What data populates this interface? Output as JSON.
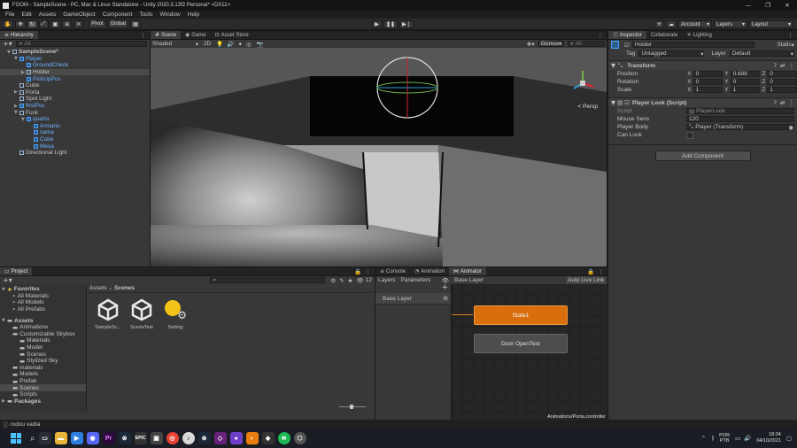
{
  "window": {
    "title": "FOOM - SampleScene - PC, Mac & Linux Standalone - Unity 2020.3.13f2 Personal* <DX11>",
    "controls": [
      "—",
      "❐",
      "✕"
    ]
  },
  "menu": [
    "File",
    "Edit",
    "Assets",
    "GameObject",
    "Component",
    "Tools",
    "Window",
    "Help"
  ],
  "toolbar": {
    "pivot": "Pivot",
    "global": "Global",
    "account": "Account",
    "layers": "Layers",
    "layout": "Layout"
  },
  "hierarchy": {
    "tab": "Hierarchy",
    "search_placeholder": "All",
    "items": [
      {
        "label": "SampleScene*",
        "level": 0,
        "arrow": "▼"
      },
      {
        "label": "Player",
        "level": 1,
        "arrow": "▼",
        "blue": true
      },
      {
        "label": "GroundCheck",
        "level": 2,
        "arrow": "",
        "blue": true
      },
      {
        "label": "Holder",
        "level": 2,
        "arrow": "▶",
        "selected": true
      },
      {
        "label": "PickUpPos",
        "level": 2,
        "arrow": "",
        "blue": true
      },
      {
        "label": "Cube",
        "level": 1,
        "arrow": ""
      },
      {
        "label": "Porta",
        "level": 1,
        "arrow": "▶"
      },
      {
        "label": "Spot Light",
        "level": 1,
        "arrow": ""
      },
      {
        "label": "firstPos",
        "level": 1,
        "arrow": "▶",
        "blue": true
      },
      {
        "label": "Fuck",
        "level": 1,
        "arrow": "▼"
      },
      {
        "label": "quarto",
        "level": 2,
        "arrow": "▼",
        "blue": true
      },
      {
        "label": "Armario",
        "level": 3,
        "arrow": "",
        "blue": true
      },
      {
        "label": "cama",
        "level": 3,
        "arrow": "",
        "blue": true
      },
      {
        "label": "Cube",
        "level": 3,
        "arrow": "",
        "blue": true
      },
      {
        "label": "Mesa",
        "level": 3,
        "arrow": "",
        "blue": true
      },
      {
        "label": "Directional Light",
        "level": 1,
        "arrow": ""
      }
    ]
  },
  "scene": {
    "tabs": [
      "Scene",
      "Game",
      "Asset Store"
    ],
    "shading": "Shaded",
    "mode_2d": "2D",
    "gizmos": "Gizmos",
    "search_placeholder": "All",
    "persp": "< Persp"
  },
  "inspector": {
    "tabs": [
      "Inspector",
      "Collaborate",
      "Lighting"
    ],
    "object_name": "Holder",
    "static_label": "Static",
    "tag_label": "Tag",
    "tag_value": "Untagged",
    "layer_label": "Layer",
    "layer_value": "Default",
    "transform": {
      "title": "Transform",
      "rows": [
        {
          "label": "Position",
          "x": "0",
          "y": "0.688",
          "z": "0"
        },
        {
          "label": "Rotation",
          "x": "0",
          "y": "0",
          "z": "0"
        },
        {
          "label": "Scale",
          "x": "1",
          "y": "1",
          "z": "1"
        }
      ]
    },
    "script_component": {
      "title": "Player Look (Script)",
      "script_label": "Script",
      "script_value": "PlayerLook",
      "sens_label": "Mouse Sens",
      "sens_value": "120",
      "body_label": "Player Body",
      "body_value": "Player (Transform)",
      "canlook_label": "Can Look"
    },
    "add_component": "Add Component"
  },
  "project": {
    "tab": "Project",
    "count": "12",
    "favorites_label": "Favorites",
    "favorites": [
      "All Materials",
      "All Models",
      "All Prefabs"
    ],
    "assets_label": "Assets",
    "tree": [
      {
        "label": "Animations",
        "level": 1
      },
      {
        "label": "Customizable Skybox",
        "level": 1
      },
      {
        "label": "Materials",
        "level": 2
      },
      {
        "label": "Model",
        "level": 2
      },
      {
        "label": "Scenes",
        "level": 2
      },
      {
        "label": "Stylized Sky",
        "level": 2
      },
      {
        "label": "materials",
        "level": 1
      },
      {
        "label": "Models",
        "level": 1
      },
      {
        "label": "Prefab",
        "level": 1
      },
      {
        "label": "Scenes",
        "level": 1,
        "selected": true
      },
      {
        "label": "Scripts",
        "level": 1
      }
    ],
    "packages_label": "Packages",
    "breadcrumb": [
      "Assets",
      "Scenes"
    ],
    "files": [
      {
        "label": "SampleSc...",
        "icon": "unity"
      },
      {
        "label": "SceneTest",
        "icon": "unity"
      },
      {
        "label": "Setting",
        "icon": "settings"
      }
    ]
  },
  "animator": {
    "tabs": [
      "Console",
      "Animation",
      "Animator"
    ],
    "subtabs": [
      "Layers",
      "Parameters"
    ],
    "layer_path": "Base Layer",
    "auto_live": "Auto Live Link",
    "layer_item": "Base Layer",
    "states": [
      {
        "label": "State1",
        "default": true
      },
      {
        "label": "Door OpenTest",
        "default": false
      }
    ],
    "footer_path": "Animations/Porta.controller"
  },
  "status_bar": "rodou vadia",
  "taskbar": {
    "lang": "POR\nPTB",
    "time": "18:34",
    "date": "04/10/2021"
  },
  "colors": {
    "accent": "#2c5d87",
    "state_orange": "#d86f0c",
    "state_gray": "#4d4d4d"
  }
}
